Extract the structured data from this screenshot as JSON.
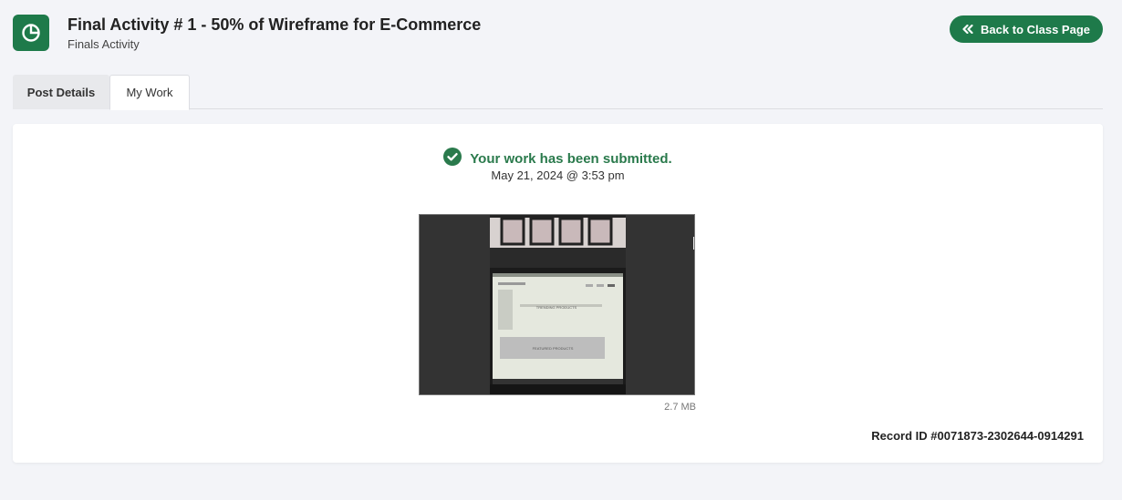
{
  "header": {
    "title": "Final Activity # 1 - 50% of Wireframe for E-Commerce",
    "subtitle": "Finals Activity",
    "icon": "pie-chart-icon",
    "back_button_label": "Back to Class Page",
    "accent_color": "#1e7a4a"
  },
  "tabs": [
    {
      "label": "Post Details",
      "active": false
    },
    {
      "label": "My Work",
      "active": true
    }
  ],
  "submission": {
    "status_text": "Your work has been submitted.",
    "status_icon": "check-circle-icon",
    "timestamp": "May 21, 2024 @ 3:53 pm",
    "attachment": {
      "size": "2.7 MB",
      "screen_heading": "TRENDING PRODUCTS",
      "screen_heading_2": "FEATURED PRODUCTS"
    },
    "record_id": "Record ID #0071873-2302644-0914291"
  }
}
